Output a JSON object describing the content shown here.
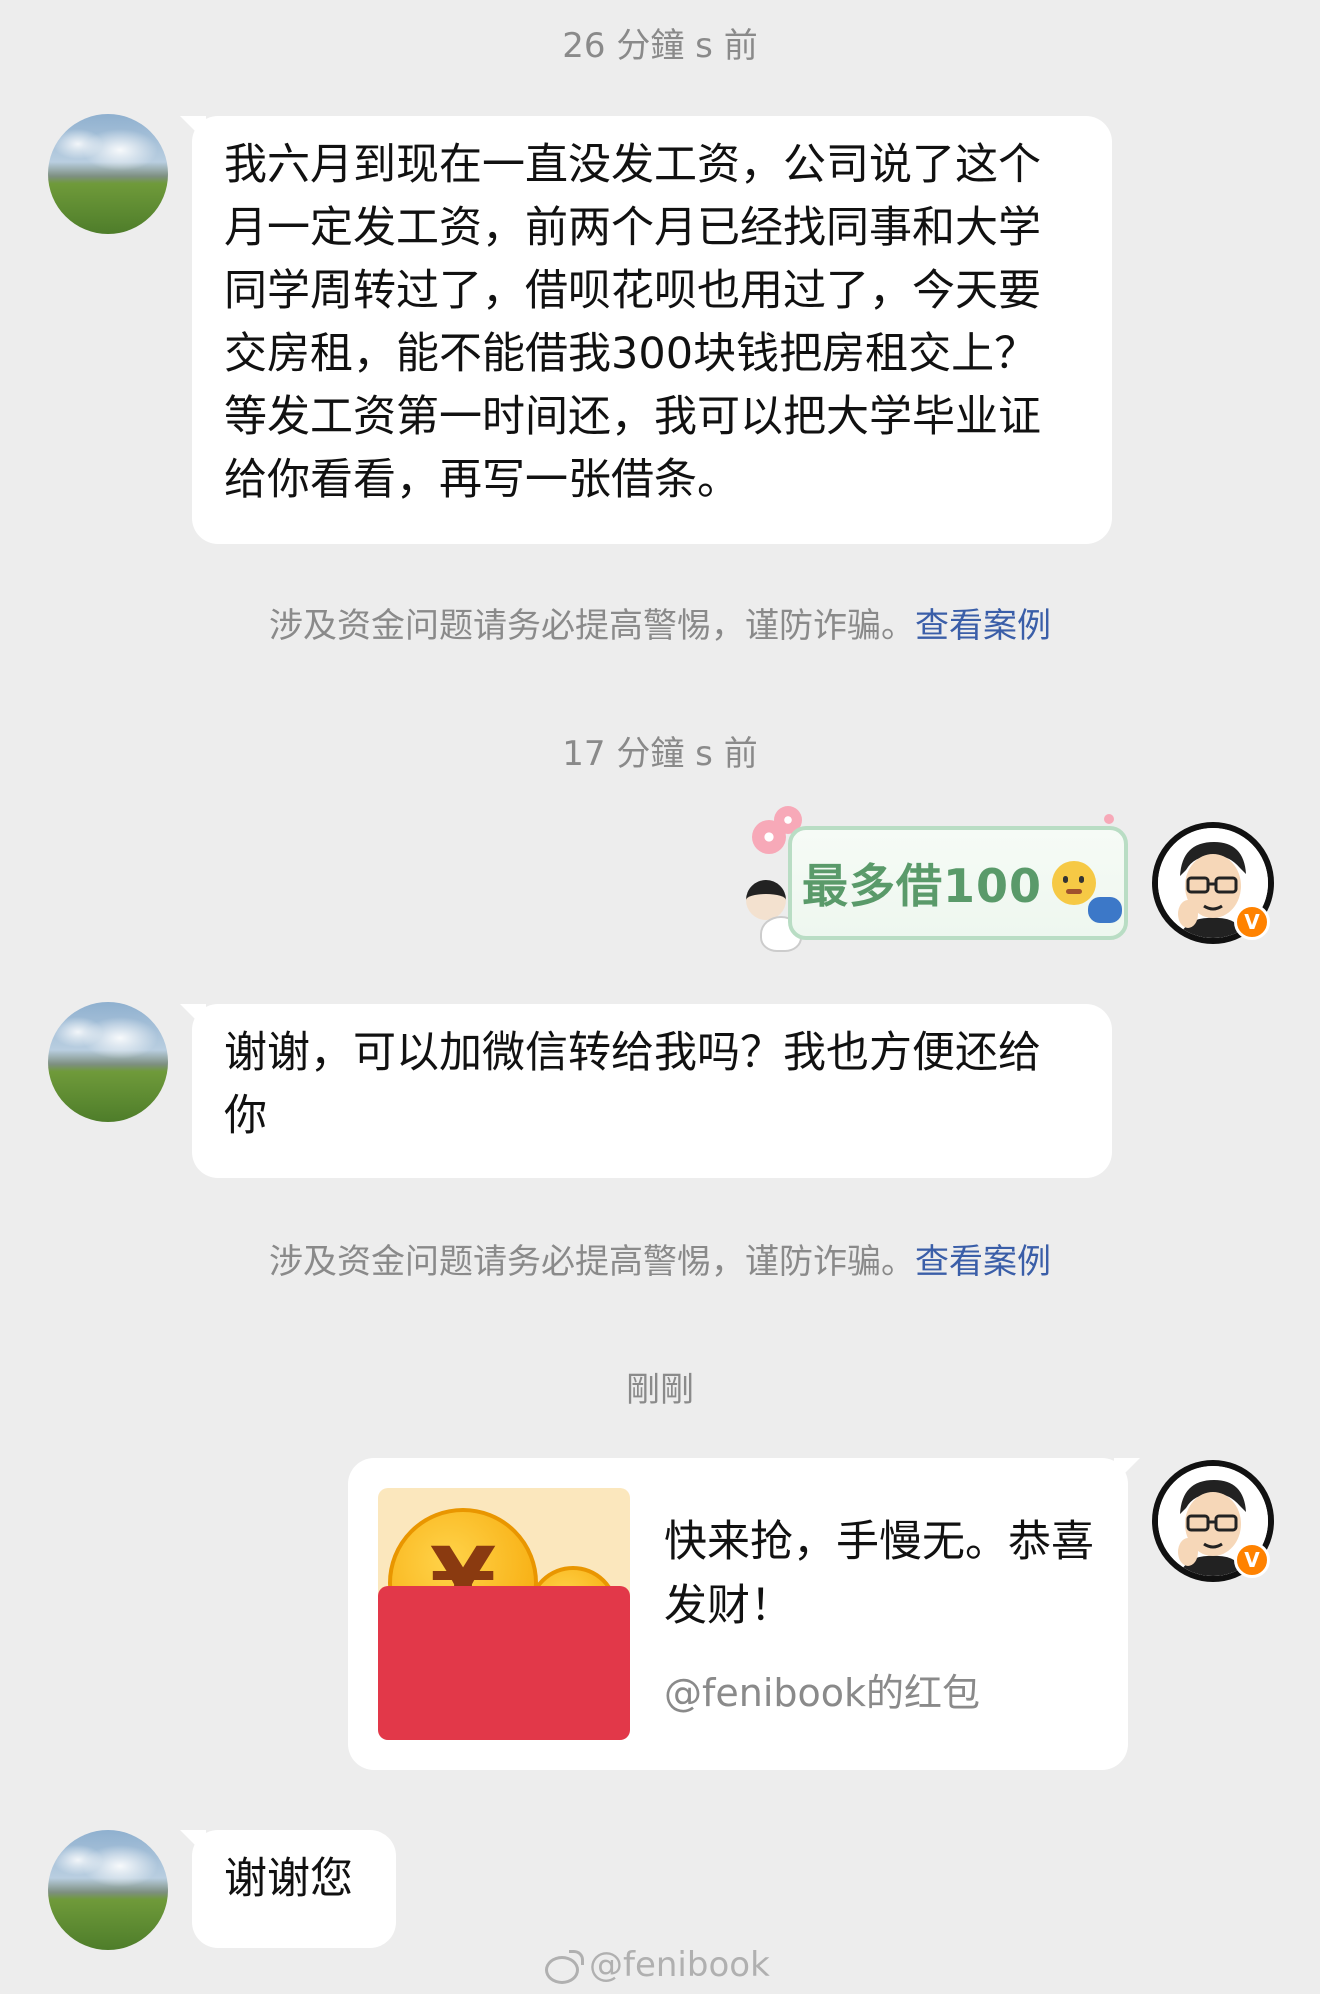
{
  "timestamps": [
    "26 分鐘 s 前",
    "17 分鐘 s 前",
    "剛剛"
  ],
  "messages": [
    {
      "text": "我六月到现在一直没发工资，公司说了这个月一定发工资，前两个月已经找同事和大学同学周转过了，借呗花呗也用过了，今天要交房租，能不能借我300块钱把房租交上？等发工资第一时间还，我可以把大学毕业证给你看看，再写一张借条。"
    },
    {
      "text": "最多借100"
    },
    {
      "text": "谢谢，可以加微信转给我吗？我也方便还给你"
    },
    {
      "text": "谢谢您"
    }
  ],
  "warning": {
    "text": "涉及资金问题请务必提高警惕，谨防诈骗。",
    "link": "查看案例"
  },
  "red_packet": {
    "title": "快来抢，手慢无。恭喜发财！",
    "subtitle": "@fenibook的红包",
    "symbol": "¥"
  },
  "badges": {
    "verified": "V"
  },
  "watermark": "@fenibook",
  "colors": {
    "background": "#ededed",
    "link": "#3a5ea8",
    "verified": "#ff8200",
    "red_packet": "#e23849"
  }
}
